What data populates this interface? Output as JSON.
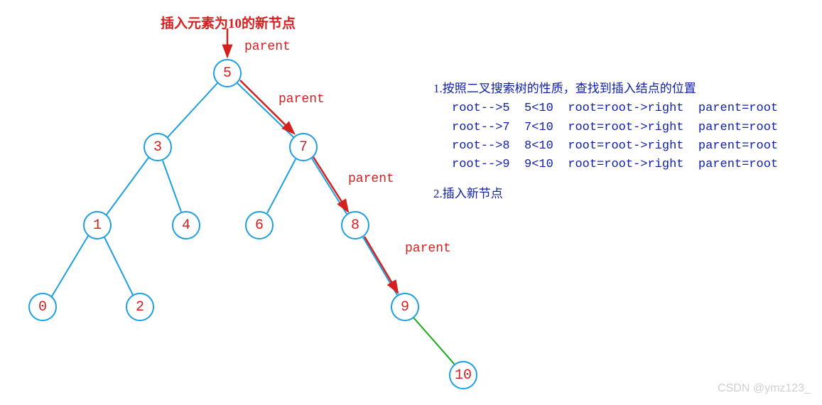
{
  "title_label": "插入元素为10的新节点",
  "parent_label": "parent",
  "nodes": {
    "n5": "5",
    "n3": "3",
    "n7": "7",
    "n1": "1",
    "n4": "4",
    "n6": "6",
    "n8": "8",
    "n0": "0",
    "n2": "2",
    "n9": "9",
    "n10": "10"
  },
  "explain": {
    "step1": "1.按照二叉搜索树的性质，查找到插入结点的位置",
    "rows": [
      {
        "a": "root-->5",
        "b": "5<10",
        "c": "root=root->right",
        "d": "parent=root"
      },
      {
        "a": "root-->7",
        "b": "7<10",
        "c": "root=root->right",
        "d": "parent=root"
      },
      {
        "a": "root-->8",
        "b": "8<10",
        "c": "root=root->right",
        "d": "parent=root"
      },
      {
        "a": "root-->9",
        "b": "9<10",
        "c": "root=root->right",
        "d": "parent=root"
      }
    ],
    "step2": "2.插入新节点"
  },
  "watermark": "CSDN @ymz123_",
  "chart_data": {
    "type": "diagram",
    "structure": "binary-search-tree",
    "title": "插入元素为10的新节点",
    "edges_blue": [
      [
        "5",
        "3"
      ],
      [
        "5",
        "7"
      ],
      [
        "3",
        "1"
      ],
      [
        "3",
        "4"
      ],
      [
        "7",
        "6"
      ],
      [
        "7",
        "8"
      ],
      [
        "1",
        "0"
      ],
      [
        "1",
        "2"
      ],
      [
        "8",
        "9"
      ]
    ],
    "edges_green": [
      [
        "9",
        "10"
      ]
    ],
    "insertion_path_red": [
      "5",
      "7",
      "8",
      "9"
    ],
    "parent_labels_along_path": [
      "parent",
      "parent",
      "parent",
      "parent"
    ],
    "explanation_steps": [
      "按照二叉搜索树的性质，查找到插入结点的位置",
      "root-->5  5<10  root=root->right  parent=root",
      "root-->7  7<10  root=root->right  parent=root",
      "root-->8  8<10  root=root->right  parent=root",
      "root-->9  9<10  root=root->right  parent=root",
      "插入新节点"
    ]
  }
}
